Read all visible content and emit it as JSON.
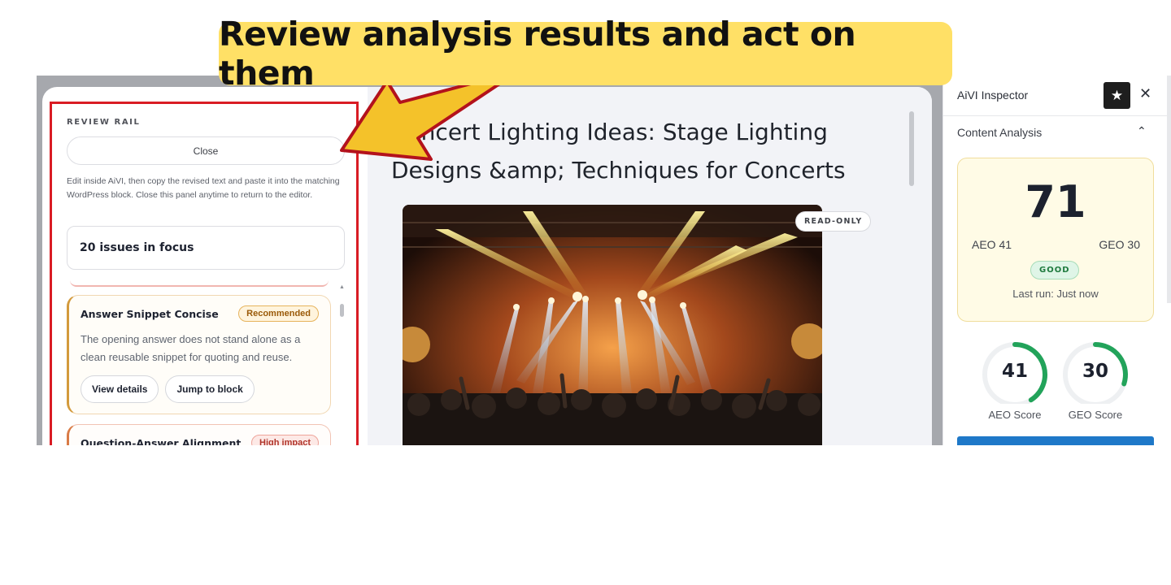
{
  "callout": {
    "text": "Review analysis results and act on them"
  },
  "review_rail": {
    "title": "REVIEW RAIL",
    "close_label": "Close",
    "help_text": "Edit inside AiVI, then copy the revised text and paste it into the matching WordPress block. Close this panel anytime to return to the editor.",
    "focus_label": "20 issues in focus",
    "cards": [
      {
        "title": "Answer Snippet Concise",
        "badge": "Recommended",
        "body": "The opening answer does not stand alone as a clean reusable snippet for quoting and reuse.",
        "actions": [
          "View details",
          "Jump to block"
        ]
      },
      {
        "title": "Question-Answer Alignment",
        "badge": "High impact"
      }
    ]
  },
  "article": {
    "title": "Concert Lighting Ideas: Stage Lighting Designs &amp; Techniques for Concerts",
    "read_only_badge": "READ-ONLY"
  },
  "inspector": {
    "title": "AiVI Inspector",
    "section": "Content Analysis",
    "overall_score": "71",
    "aeo_line": "AEO 41",
    "geo_line": "GEO 30",
    "status": "GOOD",
    "last_run": "Last run: Just now",
    "gauges": [
      {
        "value": "41",
        "label": "AEO Score",
        "fraction": 0.41
      },
      {
        "value": "30",
        "label": "GEO Score",
        "fraction": 0.3
      }
    ],
    "accent_green": "#22a35a",
    "accent_blue": "#1e78c8"
  }
}
